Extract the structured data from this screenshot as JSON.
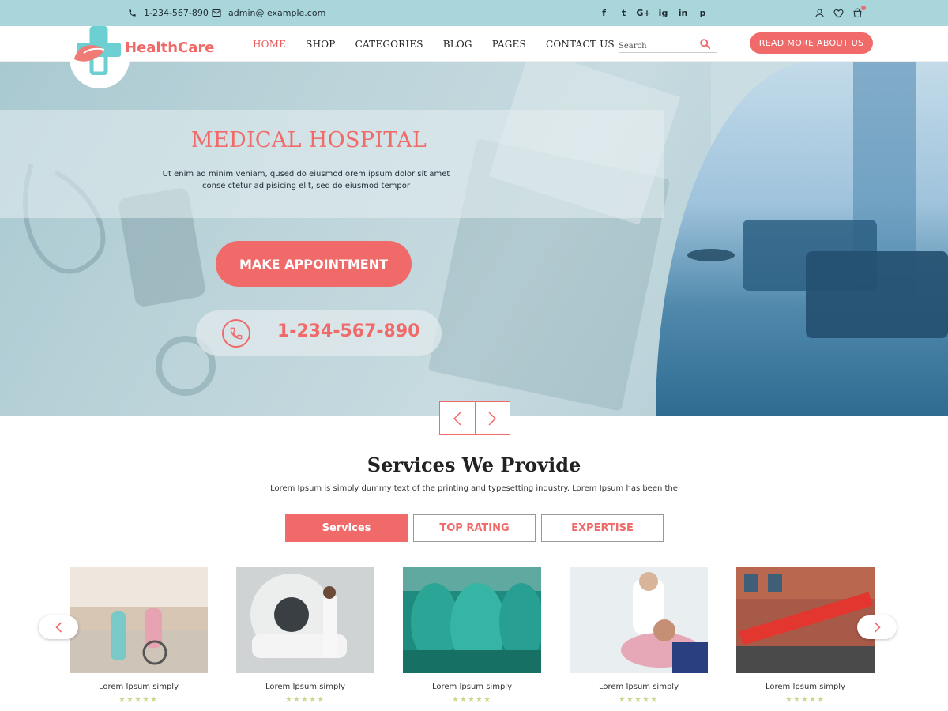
{
  "topbar": {
    "phone": "1-234-567-890",
    "email": "admin@ example.com",
    "social": [
      "f",
      "t",
      "G+",
      "ig",
      "in",
      "p"
    ]
  },
  "header": {
    "logo_text": "HealthCare",
    "nav": [
      "HOME",
      "SHOP",
      "CATEGORIES",
      "BLOG",
      "PAGES",
      "CONTACT US"
    ],
    "search_placeholder": "Search",
    "cta_label": "READ MORE ABOUT US"
  },
  "hero": {
    "title": "MEDICAL HOSPITAL",
    "text": "Ut enim ad minim veniam, qused do eiusmod orem ipsum dolor sit amet conse ctetur adipisicing elit, sed do eiusmod tempor",
    "button_label": "MAKE APPOINTMENT",
    "phone": "1-234-567-890"
  },
  "services": {
    "title": "Services We Provide",
    "subtitle": "Lorem Ipsum is simply dummy text of the printing and typesetting industry. Lorem Ipsum has been the",
    "tabs": [
      "Services",
      "TOP RATING",
      "EXPERTISE"
    ],
    "cards": [
      {
        "caption": "Lorem Ipsum simply",
        "stars": "★★★★★"
      },
      {
        "caption": "Lorem Ipsum simply",
        "stars": "★★★★★"
      },
      {
        "caption": "Lorem Ipsum simply",
        "stars": "★★★★★"
      },
      {
        "caption": "Lorem Ipsum simply",
        "stars": "★★★★★"
      },
      {
        "caption": "Lorem Ipsum simply",
        "stars": "★★★★★"
      }
    ]
  },
  "colors": {
    "accent": "#f06a6a",
    "topbar": "#a8d6db",
    "star": "#c6d98a"
  },
  "icons": [
    "phone-icon",
    "mail-icon",
    "user-icon",
    "heart-icon",
    "cart-icon",
    "search-icon",
    "chevron-left-icon",
    "chevron-right-icon"
  ]
}
